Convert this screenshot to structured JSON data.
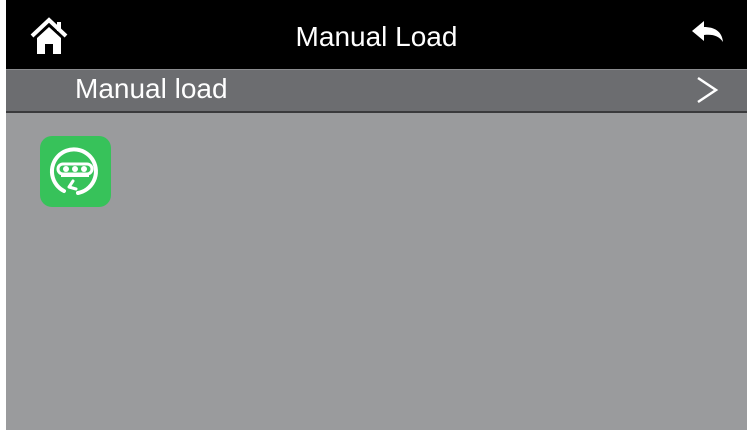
{
  "header": {
    "title": "Manual Load",
    "home_icon": "home-icon",
    "back_icon": "back-arrow-icon"
  },
  "submenu": {
    "label": "Manual load",
    "chevron_icon": "chevron-right-icon"
  },
  "apps": [
    {
      "icon": "manual-load-app-icon",
      "color": "#37c25a"
    }
  ],
  "colors": {
    "titlebar": "#000000",
    "submenu": "#6c6d70",
    "background": "#9a9b9d",
    "accent": "#37c25a"
  }
}
